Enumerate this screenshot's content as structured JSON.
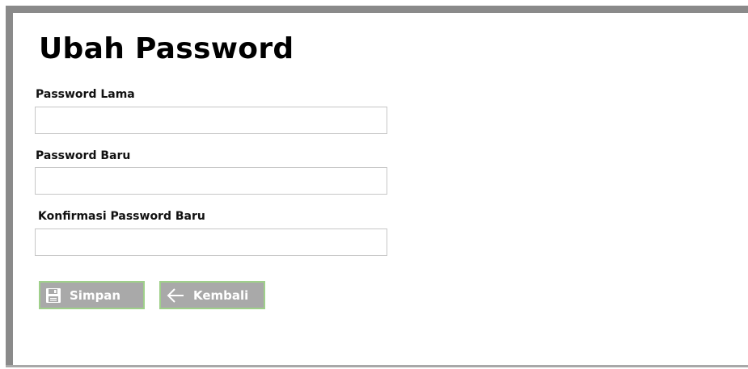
{
  "page": {
    "title": "Ubah Password"
  },
  "form": {
    "old_password": {
      "label": "Password Lama",
      "value": ""
    },
    "new_password": {
      "label": "Password Baru",
      "value": ""
    },
    "confirm_password": {
      "label": "Konfirmasi Password Baru",
      "value": ""
    }
  },
  "actions": {
    "save_label": "Simpan",
    "save_icon": "floppy-disk-icon",
    "back_label": "Kembali",
    "back_icon": "arrow-left-icon"
  },
  "colors": {
    "button_bg": "#a9a9a9",
    "button_border": "#9fd08a",
    "frame": "#8a8a8a"
  }
}
